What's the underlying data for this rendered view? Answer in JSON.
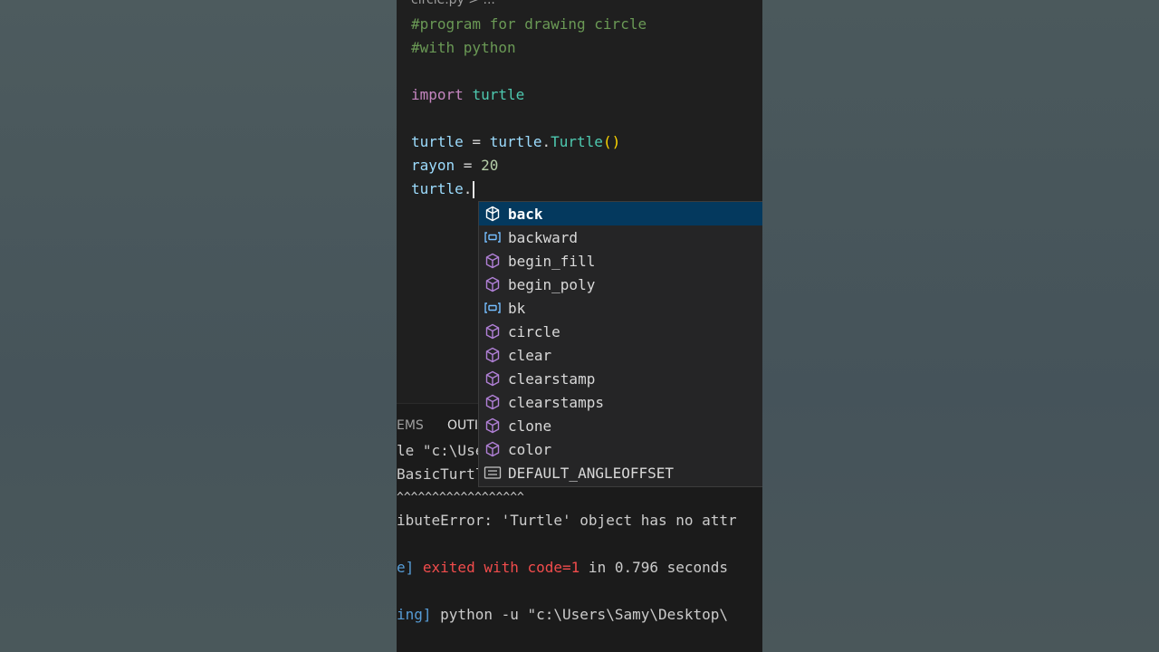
{
  "editor": {
    "breadcrumb": "circle.py > ...",
    "lines": {
      "l1": "#program for drawing circle",
      "l2": "#with python",
      "l4_kw": "import",
      "l4_mod": "turtle",
      "l6_var": "turtle",
      "l6_eq": " = ",
      "l6_mod": "turtle",
      "l6_dot": ".",
      "l6_fn": "Turtle",
      "l6_paren": "()",
      "l7_var": "rayon",
      "l7_eq": " = ",
      "l7_num": "20",
      "l8_var": "turtle",
      "l8_dot": "."
    }
  },
  "suggestions": {
    "items": [
      {
        "label": "back",
        "icon": "method-cube-icon"
      },
      {
        "label": "backward",
        "icon": "variable-icon"
      },
      {
        "label": "begin_fill",
        "icon": "method-cube-icon"
      },
      {
        "label": "begin_poly",
        "icon": "method-cube-icon"
      },
      {
        "label": "bk",
        "icon": "variable-icon"
      },
      {
        "label": "circle",
        "icon": "method-cube-icon"
      },
      {
        "label": "clear",
        "icon": "method-cube-icon"
      },
      {
        "label": "clearstamp",
        "icon": "method-cube-icon"
      },
      {
        "label": "clearstamps",
        "icon": "method-cube-icon"
      },
      {
        "label": "clone",
        "icon": "method-cube-icon"
      },
      {
        "label": "color",
        "icon": "method-cube-icon"
      },
      {
        "label": "DEFAULT_ANGLEOFFSET",
        "icon": "constant-icon"
      }
    ],
    "selected_index": 0
  },
  "panel": {
    "tabs": [
      "EMS",
      "OUTI"
    ],
    "output": {
      "o1": "le \"c:\\Use",
      "o2": "BasicTurtl",
      "o3": "^^^^^^^^^^^^^^^^^^",
      "o4": "ibuteError: 'Turtle' object has no attr",
      "o6_a": "e]",
      "o6_b": " exited with ",
      "o6_c": "code=1",
      "o6_d": " in ",
      "o6_e": "0.796",
      "o6_f": " seconds",
      "o8_a": "ing]",
      "o8_b": " python -u \"c:\\Users\\Samy\\Desktop\\"
    }
  },
  "colors": {
    "background": "#4c5a5d",
    "editor_bg": "#1f1f1f",
    "suggest_bg": "#252526",
    "selected_bg": "#04395e",
    "method_icon": "#b180d7",
    "variable_icon": "#75beff"
  }
}
